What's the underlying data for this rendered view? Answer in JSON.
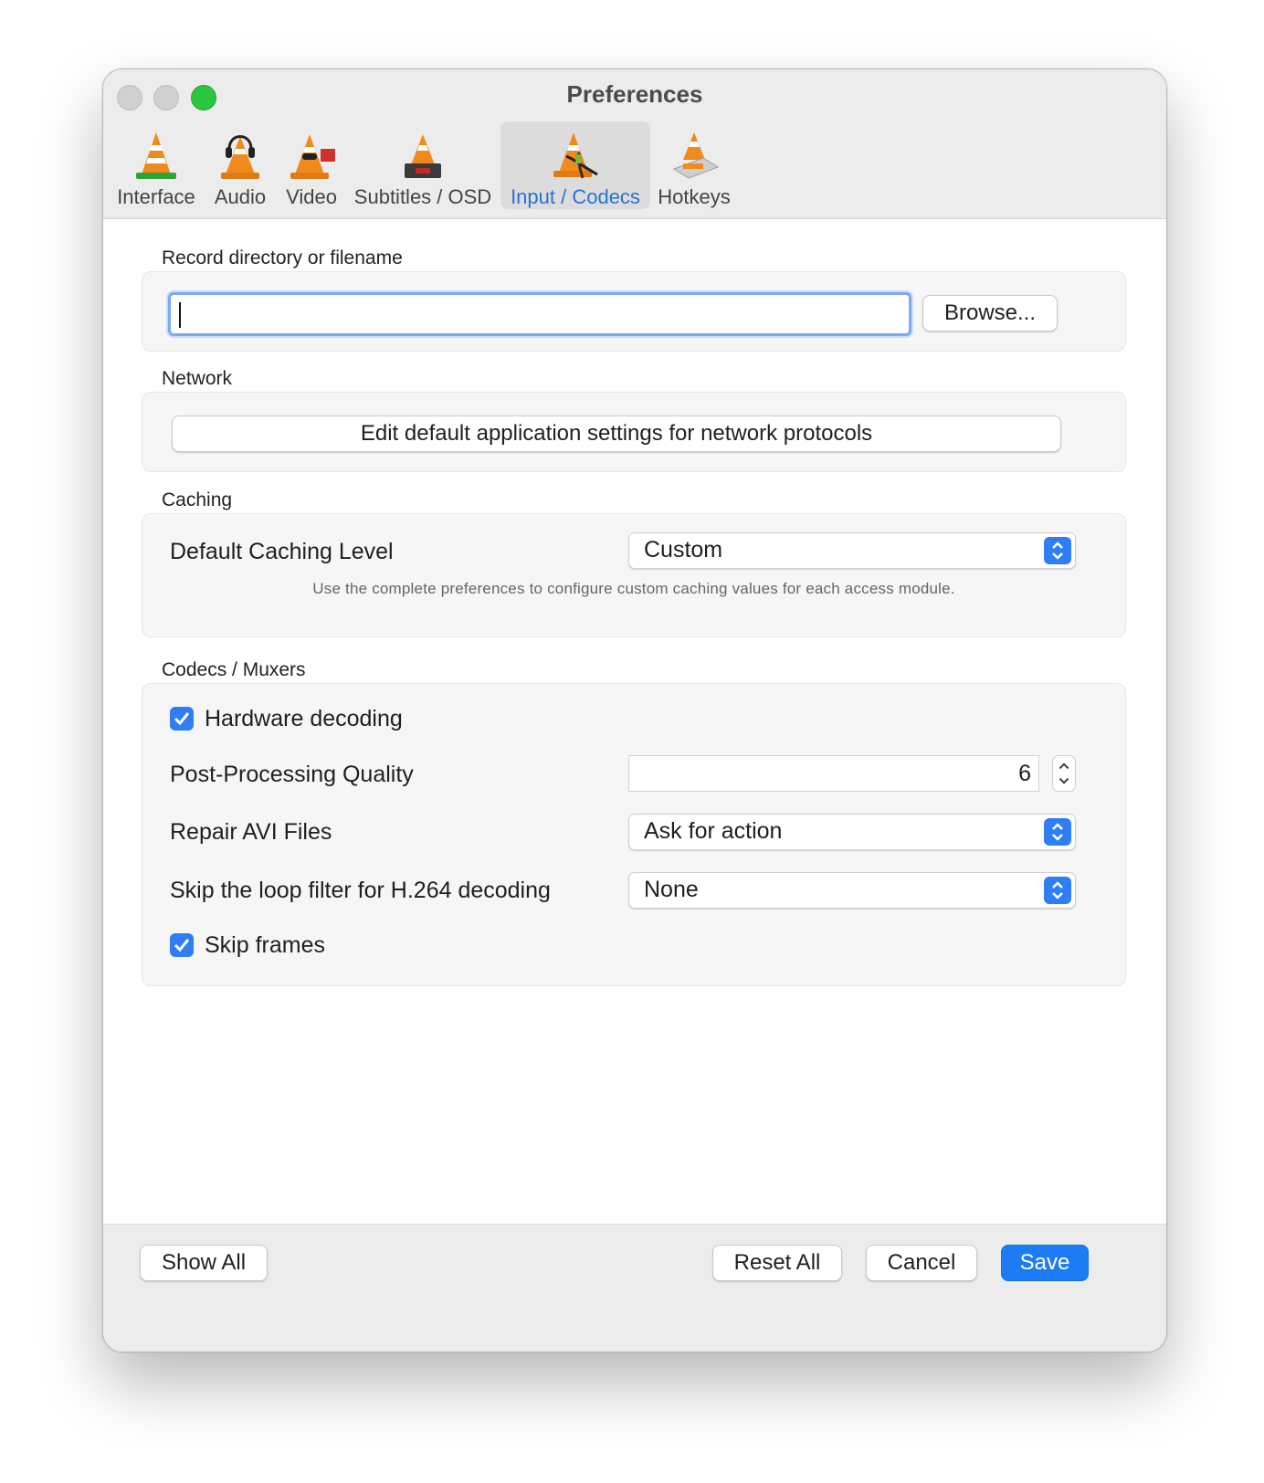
{
  "window": {
    "title": "Preferences"
  },
  "tabs": [
    {
      "label": "Interface",
      "icon": "vlc-cone-interface-icon"
    },
    {
      "label": "Audio",
      "icon": "vlc-cone-headphones-icon"
    },
    {
      "label": "Video",
      "icon": "vlc-cone-video-icon"
    },
    {
      "label": "Subtitles / OSD",
      "icon": "vlc-cone-subtitles-icon"
    },
    {
      "label": "Input / Codecs",
      "icon": "vlc-cone-input-icon",
      "active": true
    },
    {
      "label": "Hotkeys",
      "icon": "vlc-cone-hotkeys-icon"
    }
  ],
  "record": {
    "label": "Record directory or filename",
    "value": "",
    "browse_label": "Browse..."
  },
  "network": {
    "label": "Network",
    "button_label": "Edit default application settings for network protocols"
  },
  "caching": {
    "label": "Caching",
    "level_label": "Default Caching Level",
    "level_value": "Custom",
    "help": "Use the complete preferences to configure custom caching values for each access module."
  },
  "codecs": {
    "label": "Codecs / Muxers",
    "hw_decoding_label": "Hardware decoding",
    "hw_decoding_checked": true,
    "pp_quality_label": "Post-Processing Quality",
    "pp_quality_value": "6",
    "repair_avi_label": "Repair AVI Files",
    "repair_avi_value": "Ask for action",
    "skip_loop_label": "Skip the loop filter for H.264 decoding",
    "skip_loop_value": "None",
    "skip_frames_label": "Skip frames",
    "skip_frames_checked": true
  },
  "footer": {
    "show_all": "Show All",
    "reset_all": "Reset All",
    "cancel": "Cancel",
    "save": "Save"
  },
  "colors": {
    "accent": "#2f7ef5",
    "active_tab_text": "#2a70d6",
    "zoom_button": "#2cc53f"
  }
}
